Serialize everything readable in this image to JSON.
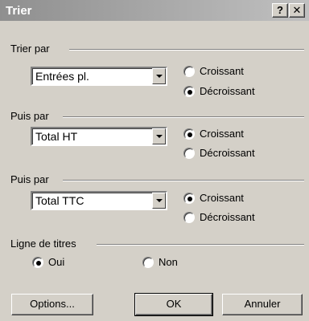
{
  "window": {
    "title": "Trier",
    "help_label": "?",
    "close_label": "✕"
  },
  "groups": [
    {
      "label": "Trier par",
      "selected": "Entrées pl.",
      "options": [
        "Croissant",
        "Décroissant"
      ],
      "checked": 1
    },
    {
      "label": "Puis par",
      "selected": "Total HT",
      "options": [
        "Croissant",
        "Décroissant"
      ],
      "checked": 0
    },
    {
      "label": "Puis par",
      "selected": "Total TTC",
      "options": [
        "Croissant",
        "Décroissant"
      ],
      "checked": 0
    }
  ],
  "header_row": {
    "label": "Ligne de titres",
    "yes_label": "Oui",
    "no_label": "Non",
    "checked": "yes"
  },
  "buttons": {
    "options_label": "Options...",
    "ok_label": "OK",
    "cancel_label": "Annuler"
  }
}
